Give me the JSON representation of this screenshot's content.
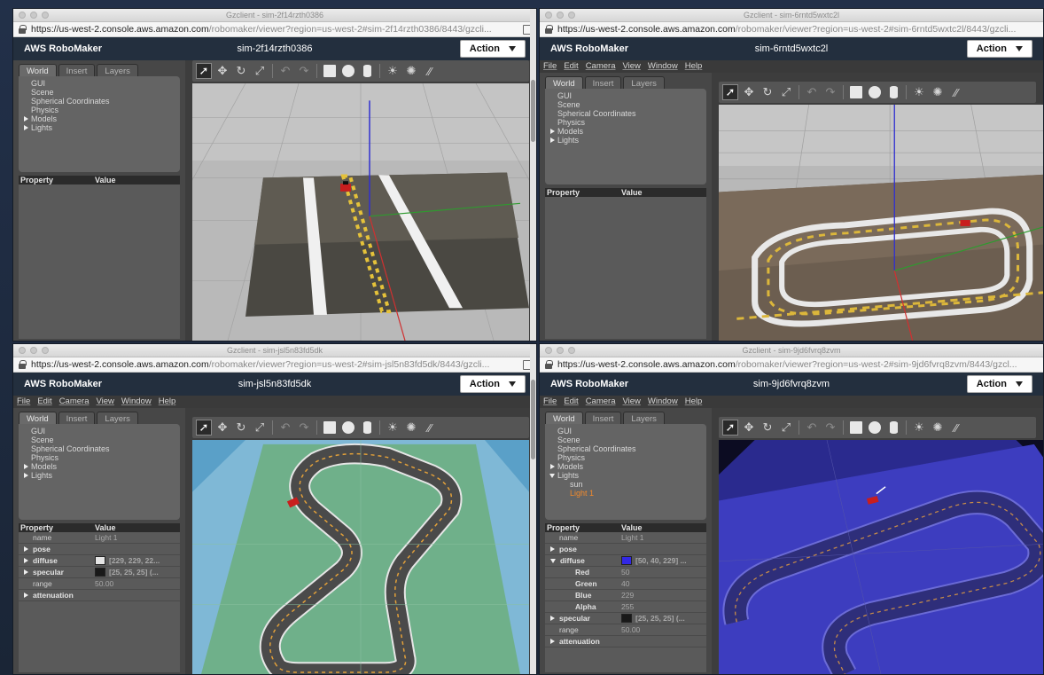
{
  "app_brand": "AWS RoboMaker",
  "action_label": "Action",
  "url_base": "https://us-west-2.console.aws.amazon.com",
  "menu": [
    "File",
    "Edit",
    "Camera",
    "View",
    "Window",
    "Help"
  ],
  "tabs": [
    "World",
    "Insert",
    "Layers"
  ],
  "tree": [
    "GUI",
    "Scene",
    "Spherical Coordinates",
    "Physics",
    "Models",
    "Lights"
  ],
  "prop_headers": {
    "property": "Property",
    "value": "Value"
  },
  "windows": [
    {
      "window_title": "Gzclient - sim-2f14rzth0386",
      "url_rest": "/robomaker/viewer?region=us-west-2#sim-2f14rzth0386/8443/gzcli...",
      "sim": "sim-2f14rzth0386"
    },
    {
      "window_title": "Gzclient - sim-6rntd5wxtc2l",
      "url_rest": "/robomaker/viewer?region=us-west-2#sim-6rntd5wxtc2l/8443/gzcli...",
      "sim": "sim-6rntd5wxtc2l"
    },
    {
      "window_title": "Gzclient - sim-jsl5n83fd5dk",
      "url_rest": "/robomaker/viewer?region=us-west-2#sim-jsl5n83fd5dk/8443/gzcli...",
      "sim": "sim-jsl5n83fd5dk",
      "props": {
        "name_key": "name",
        "name_val": "Light 1",
        "pose": "pose",
        "diffuse": "diffuse",
        "diffuse_val": "[229, 229, 22...",
        "diffuse_color": "#e5e5e5",
        "specular": "specular",
        "specular_val": "[25, 25, 25] (...",
        "specular_color": "#191919",
        "range_key": "range",
        "range_val": "50.00",
        "attenuation": "attenuation"
      }
    },
    {
      "window_title": "Gzclient - sim-9jd6fvrq8zvm",
      "url_rest": "/robomaker/viewer?region=us-west-2#sim-9jd6fvrq8zvm/8443/gzcl...",
      "sim": "sim-9jd6fvrq8zvm",
      "lights": [
        "sun",
        "Light 1"
      ],
      "props": {
        "name_key": "name",
        "name_val": "Light 1",
        "pose": "pose",
        "diffuse": "diffuse",
        "diffuse_val": "[50, 40, 229] ...",
        "diffuse_color": "#3228e5",
        "red": "Red",
        "red_val": "50",
        "green": "Green",
        "green_val": "40",
        "blue": "Blue",
        "blue_val": "229",
        "alpha": "Alpha",
        "alpha_val": "255",
        "specular": "specular",
        "specular_val": "[25, 25, 25] (...",
        "specular_color": "#191919",
        "range_key": "range",
        "range_val": "50.00",
        "attenuation": "attenuation"
      }
    }
  ]
}
